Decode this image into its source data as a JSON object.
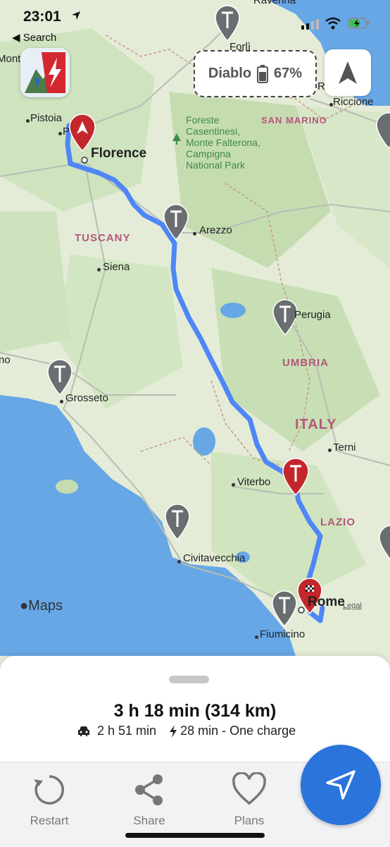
{
  "status_bar": {
    "time": "23:01",
    "back_label": "Search"
  },
  "vehicle": {
    "name": "Diablo",
    "battery": "67%"
  },
  "map": {
    "places": [
      {
        "id": "ravenna",
        "name": "Ravenna"
      },
      {
        "id": "forli",
        "name": "Forlì"
      },
      {
        "id": "rimini",
        "name": "R"
      },
      {
        "id": "riccione",
        "name": "Riccione"
      },
      {
        "id": "montecatini",
        "name": "Monte"
      },
      {
        "id": "pistoia",
        "name": "Pistoia"
      },
      {
        "id": "prato",
        "name": "P"
      },
      {
        "id": "florence",
        "name": "Florence"
      },
      {
        "id": "arezzo",
        "name": "Arezzo"
      },
      {
        "id": "siena",
        "name": "Siena"
      },
      {
        "id": "perugia",
        "name": "Perugia"
      },
      {
        "id": "grosseto",
        "name": "Grosseto"
      },
      {
        "id": "terni",
        "name": "Terni"
      },
      {
        "id": "viterbo",
        "name": "Viterbo"
      },
      {
        "id": "civitavecchia",
        "name": "Civitavecchia"
      },
      {
        "id": "rome",
        "name": "Rome"
      },
      {
        "id": "fiumicino",
        "name": "Fiumicino"
      },
      {
        "id": "no",
        "name": "no"
      }
    ],
    "regions": {
      "tuscany": "TUSCANY",
      "umbria": "UMBRIA",
      "lazio": "LAZIO",
      "san_marino": "SAN MARINO",
      "italy": "ITALY"
    },
    "park": [
      "Foreste",
      "Casentinesi,",
      "Monte Falterona,",
      "Campigna",
      "National Park"
    ],
    "attribution": "Maps",
    "legal": "Legal"
  },
  "route": {
    "summary": "3 h 18 min (314 km)",
    "drive_time": "2 h 51 min",
    "charge_time": "28 min - One charge"
  },
  "toolbar": {
    "restart": "Restart",
    "share": "Share",
    "plans": "Plans"
  },
  "colors": {
    "route": "#4f86f7",
    "accent": "#2a74db",
    "charger_pin": "#6b6e70",
    "stop_pin": "#c3272b",
    "sea": "#67a7e6"
  }
}
